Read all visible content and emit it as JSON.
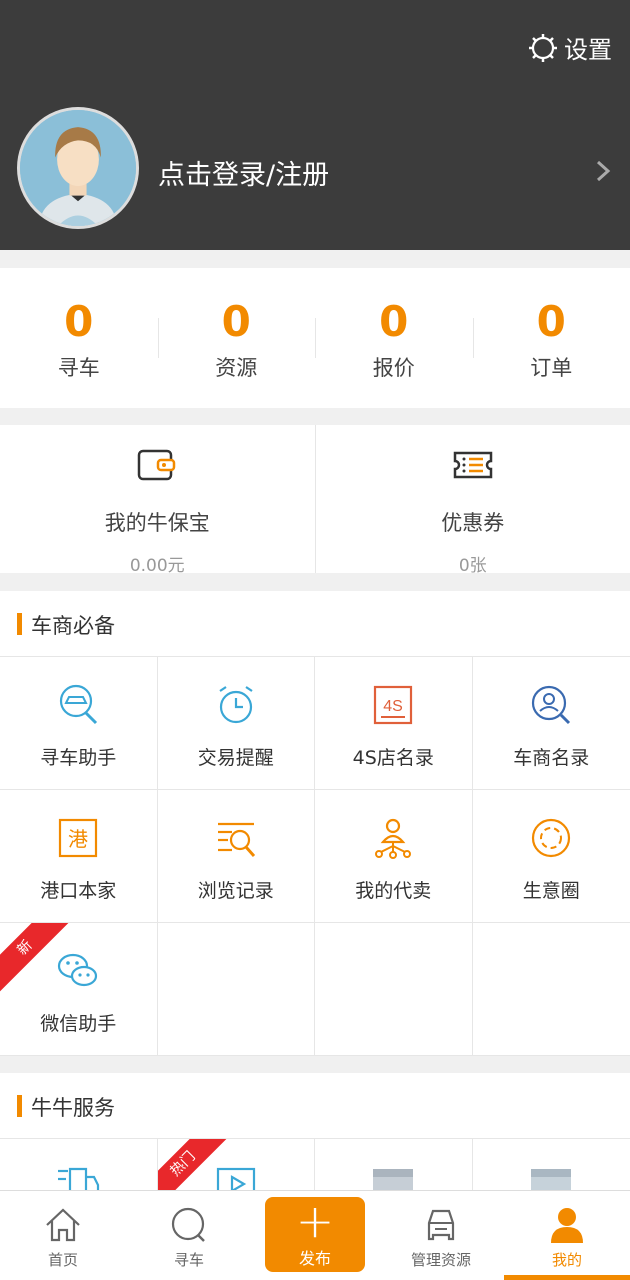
{
  "header": {
    "settings_label": "设置",
    "login_text": "点击登录/注册",
    "bg_color": "#3c3c3c"
  },
  "stats": [
    {
      "value": "0",
      "label": "寻车"
    },
    {
      "value": "0",
      "label": "资源"
    },
    {
      "value": "0",
      "label": "报价"
    },
    {
      "value": "0",
      "label": "订单"
    }
  ],
  "wallet": [
    {
      "icon": "wallet-icon",
      "title": "我的牛保宝",
      "sub": "0.00元"
    },
    {
      "icon": "coupon-icon",
      "title": "优惠券",
      "sub": "0张"
    }
  ],
  "section1": {
    "title": "车商必备",
    "items": [
      {
        "label": "寻车助手",
        "icon": "car-search-icon"
      },
      {
        "label": "交易提醒",
        "icon": "alarm-clock-icon"
      },
      {
        "label": "4S店名录",
        "icon": "4s-store-icon"
      },
      {
        "label": "车商名录",
        "icon": "dealer-search-icon"
      },
      {
        "label": "港口本家",
        "icon": "port-icon"
      },
      {
        "label": "浏览记录",
        "icon": "browse-history-icon"
      },
      {
        "label": "我的代卖",
        "icon": "consignment-icon"
      },
      {
        "label": "生意圈",
        "icon": "business-circle-icon"
      },
      {
        "label": "微信助手",
        "icon": "wechat-icon",
        "badge": "新"
      }
    ]
  },
  "section2": {
    "title": "牛牛服务",
    "badge": "热门"
  },
  "tabbar": {
    "items": [
      {
        "label": "首页",
        "icon": "home-icon"
      },
      {
        "label": "寻车",
        "icon": "search-icon"
      },
      {
        "label": "发布",
        "icon": "plus-icon"
      },
      {
        "label": "管理资源",
        "icon": "car-manage-icon"
      },
      {
        "label": "我的",
        "icon": "user-icon",
        "active": true
      }
    ]
  },
  "colors": {
    "accent": "#f28a00",
    "badge_red": "#e8282b"
  }
}
